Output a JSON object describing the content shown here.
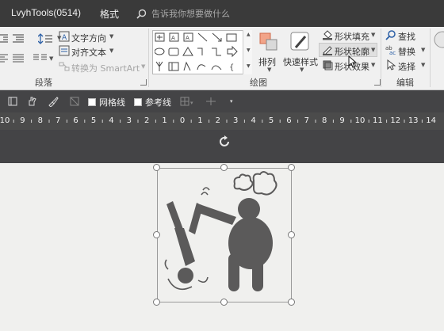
{
  "titlebar": {
    "tabs": [
      {
        "label": "LvyhTools(0514)"
      },
      {
        "label": "格式"
      }
    ],
    "tell_me_placeholder": "告诉我你想要做什么"
  },
  "ribbon": {
    "paragraph": {
      "text_direction": "文字方向",
      "align_text": "对齐文本",
      "convert_smartart": "转换为 SmartArt",
      "group_label": "段落"
    },
    "drawing": {
      "arrange": "排列",
      "quick_styles": "快速样式",
      "shape_fill": "形状填充",
      "shape_outline": "形状轮廓",
      "shape_effects": "形状效果",
      "group_label": "绘图"
    },
    "editing": {
      "find": "查找",
      "replace": "替换",
      "select": "选择",
      "group_label": "编辑"
    }
  },
  "quick_access": {
    "gridlines": "网格线",
    "guides": "参考线"
  },
  "ruler": {
    "labels": [
      "10",
      "9",
      "8",
      "7",
      "6",
      "5",
      "4",
      "3",
      "2",
      "1",
      "0",
      "1",
      "2",
      "3",
      "4",
      "5",
      "6",
      "7",
      "8",
      "9",
      "10",
      "11",
      "12",
      "13",
      "14"
    ]
  },
  "colors": {
    "titlebar": "#3a3a3a",
    "ribbon": "#f0f0f0",
    "dark_bar": "#444446",
    "canvas": "#f0f0ee",
    "pictogram": "#5b5a5a"
  },
  "icons": {
    "search": "search-icon",
    "rotate": "rotate-handle-icon",
    "dropdown": "chevron-down-icon"
  }
}
